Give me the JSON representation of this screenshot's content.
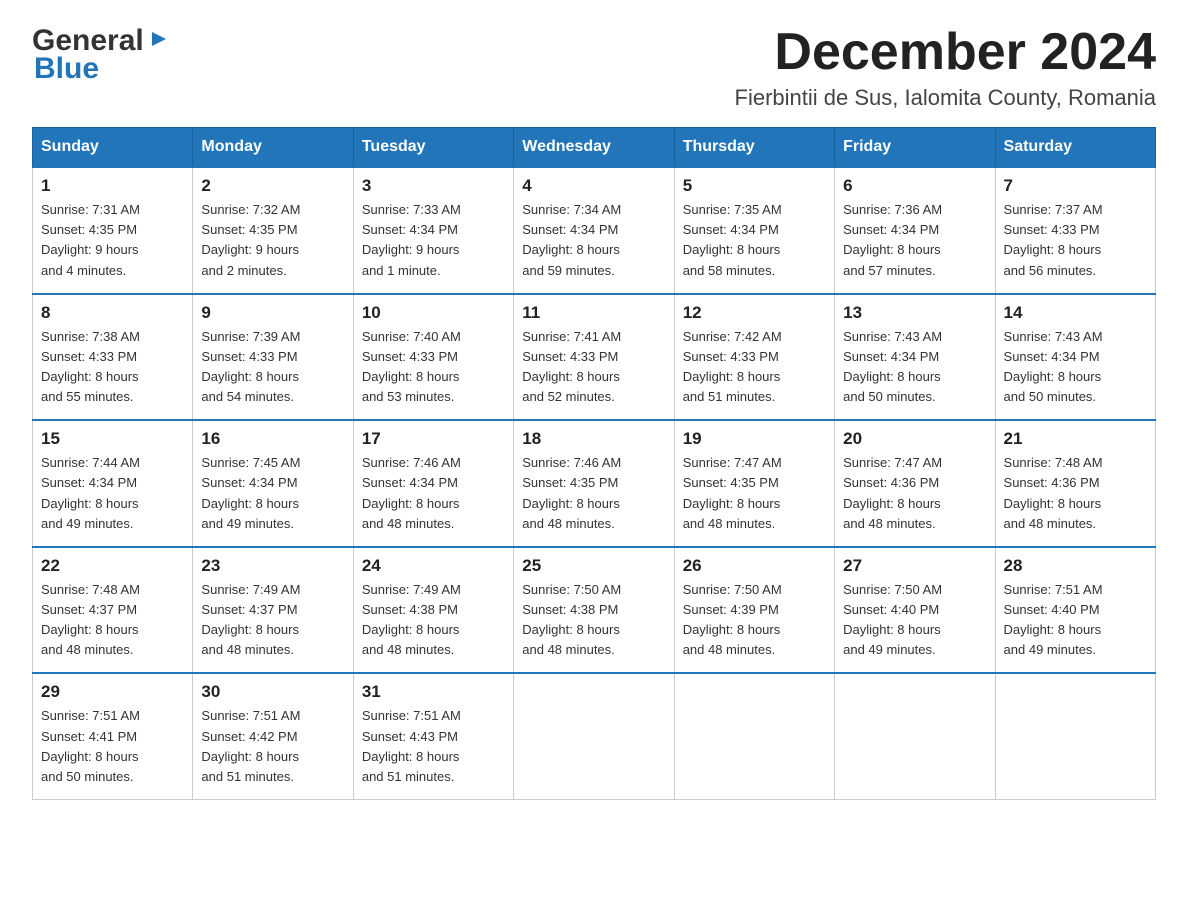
{
  "logo": {
    "general": "General",
    "arrow": "▶",
    "blue": "Blue"
  },
  "title": "December 2024",
  "subtitle": "Fierbintii de Sus, Ialomita County, Romania",
  "days_of_week": [
    "Sunday",
    "Monday",
    "Tuesday",
    "Wednesday",
    "Thursday",
    "Friday",
    "Saturday"
  ],
  "weeks": [
    [
      {
        "day": "1",
        "sunrise": "7:31 AM",
        "sunset": "4:35 PM",
        "daylight": "9 hours and 4 minutes."
      },
      {
        "day": "2",
        "sunrise": "7:32 AM",
        "sunset": "4:35 PM",
        "daylight": "9 hours and 2 minutes."
      },
      {
        "day": "3",
        "sunrise": "7:33 AM",
        "sunset": "4:34 PM",
        "daylight": "9 hours and 1 minute."
      },
      {
        "day": "4",
        "sunrise": "7:34 AM",
        "sunset": "4:34 PM",
        "daylight": "8 hours and 59 minutes."
      },
      {
        "day": "5",
        "sunrise": "7:35 AM",
        "sunset": "4:34 PM",
        "daylight": "8 hours and 58 minutes."
      },
      {
        "day": "6",
        "sunrise": "7:36 AM",
        "sunset": "4:34 PM",
        "daylight": "8 hours and 57 minutes."
      },
      {
        "day": "7",
        "sunrise": "7:37 AM",
        "sunset": "4:33 PM",
        "daylight": "8 hours and 56 minutes."
      }
    ],
    [
      {
        "day": "8",
        "sunrise": "7:38 AM",
        "sunset": "4:33 PM",
        "daylight": "8 hours and 55 minutes."
      },
      {
        "day": "9",
        "sunrise": "7:39 AM",
        "sunset": "4:33 PM",
        "daylight": "8 hours and 54 minutes."
      },
      {
        "day": "10",
        "sunrise": "7:40 AM",
        "sunset": "4:33 PM",
        "daylight": "8 hours and 53 minutes."
      },
      {
        "day": "11",
        "sunrise": "7:41 AM",
        "sunset": "4:33 PM",
        "daylight": "8 hours and 52 minutes."
      },
      {
        "day": "12",
        "sunrise": "7:42 AM",
        "sunset": "4:33 PM",
        "daylight": "8 hours and 51 minutes."
      },
      {
        "day": "13",
        "sunrise": "7:43 AM",
        "sunset": "4:34 PM",
        "daylight": "8 hours and 50 minutes."
      },
      {
        "day": "14",
        "sunrise": "7:43 AM",
        "sunset": "4:34 PM",
        "daylight": "8 hours and 50 minutes."
      }
    ],
    [
      {
        "day": "15",
        "sunrise": "7:44 AM",
        "sunset": "4:34 PM",
        "daylight": "8 hours and 49 minutes."
      },
      {
        "day": "16",
        "sunrise": "7:45 AM",
        "sunset": "4:34 PM",
        "daylight": "8 hours and 49 minutes."
      },
      {
        "day": "17",
        "sunrise": "7:46 AM",
        "sunset": "4:34 PM",
        "daylight": "8 hours and 48 minutes."
      },
      {
        "day": "18",
        "sunrise": "7:46 AM",
        "sunset": "4:35 PM",
        "daylight": "8 hours and 48 minutes."
      },
      {
        "day": "19",
        "sunrise": "7:47 AM",
        "sunset": "4:35 PM",
        "daylight": "8 hours and 48 minutes."
      },
      {
        "day": "20",
        "sunrise": "7:47 AM",
        "sunset": "4:36 PM",
        "daylight": "8 hours and 48 minutes."
      },
      {
        "day": "21",
        "sunrise": "7:48 AM",
        "sunset": "4:36 PM",
        "daylight": "8 hours and 48 minutes."
      }
    ],
    [
      {
        "day": "22",
        "sunrise": "7:48 AM",
        "sunset": "4:37 PM",
        "daylight": "8 hours and 48 minutes."
      },
      {
        "day": "23",
        "sunrise": "7:49 AM",
        "sunset": "4:37 PM",
        "daylight": "8 hours and 48 minutes."
      },
      {
        "day": "24",
        "sunrise": "7:49 AM",
        "sunset": "4:38 PM",
        "daylight": "8 hours and 48 minutes."
      },
      {
        "day": "25",
        "sunrise": "7:50 AM",
        "sunset": "4:38 PM",
        "daylight": "8 hours and 48 minutes."
      },
      {
        "day": "26",
        "sunrise": "7:50 AM",
        "sunset": "4:39 PM",
        "daylight": "8 hours and 48 minutes."
      },
      {
        "day": "27",
        "sunrise": "7:50 AM",
        "sunset": "4:40 PM",
        "daylight": "8 hours and 49 minutes."
      },
      {
        "day": "28",
        "sunrise": "7:51 AM",
        "sunset": "4:40 PM",
        "daylight": "8 hours and 49 minutes."
      }
    ],
    [
      {
        "day": "29",
        "sunrise": "7:51 AM",
        "sunset": "4:41 PM",
        "daylight": "8 hours and 50 minutes."
      },
      {
        "day": "30",
        "sunrise": "7:51 AM",
        "sunset": "4:42 PM",
        "daylight": "8 hours and 51 minutes."
      },
      {
        "day": "31",
        "sunrise": "7:51 AM",
        "sunset": "4:43 PM",
        "daylight": "8 hours and 51 minutes."
      },
      null,
      null,
      null,
      null
    ]
  ],
  "labels": {
    "sunrise": "Sunrise:",
    "sunset": "Sunset:",
    "daylight": "Daylight:"
  }
}
